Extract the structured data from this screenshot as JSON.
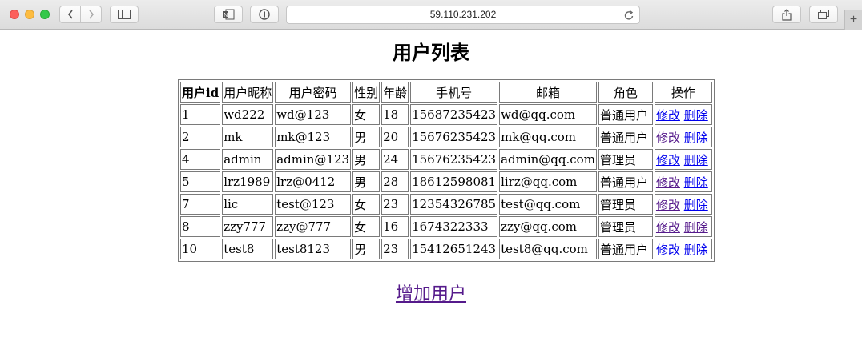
{
  "browser": {
    "address": "59.110.231.202",
    "icons": {
      "back": "chevron-left-icon",
      "forward": "chevron-right-icon",
      "sidebar": "sidebar-icon",
      "onenote": "onenote-icon",
      "password": "password-icon",
      "reload": "reload-icon",
      "share": "share-icon",
      "tabs": "tabs-icon",
      "new_tab": "plus-icon"
    },
    "new_tab_label": "+"
  },
  "page": {
    "title": "用户列表",
    "columns": [
      "用户id",
      "用户昵称",
      "用户密码",
      "性别",
      "年龄",
      "手机号",
      "邮箱",
      "角色",
      "操作"
    ],
    "rows": [
      {
        "id": "1",
        "nickname": "wd222",
        "password": "wd@123",
        "gender": "女",
        "age": "18",
        "phone": "15687235423",
        "email": "wd@qq.com",
        "role": "普通用户",
        "edit": "修改",
        "delete": "删除"
      },
      {
        "id": "2",
        "nickname": "mk",
        "password": "mk@123",
        "gender": "男",
        "age": "20",
        "phone": "15676235423",
        "email": "mk@qq.com",
        "role": "普通用户",
        "edit": "修改",
        "delete": "删除"
      },
      {
        "id": "4",
        "nickname": "admin",
        "password": "admin@123",
        "gender": "男",
        "age": "24",
        "phone": "15676235423",
        "email": "admin@qq.com",
        "role": "管理员",
        "edit": "修改",
        "delete": "删除"
      },
      {
        "id": "5",
        "nickname": "lrz1989",
        "password": "lrz@0412",
        "gender": "男",
        "age": "28",
        "phone": "18612598081",
        "email": "lirz@qq.com",
        "role": "普通用户",
        "edit": "修改",
        "delete": "删除"
      },
      {
        "id": "7",
        "nickname": "lic",
        "password": "test@123",
        "gender": "女",
        "age": "23",
        "phone": "12354326785",
        "email": "test@qq.com",
        "role": "管理员",
        "edit": "修改",
        "delete": "删除"
      },
      {
        "id": "8",
        "nickname": "zzy777",
        "password": "zzy@777",
        "gender": "女",
        "age": "16",
        "phone": "1674322333",
        "email": "zzy@qq.com",
        "role": "管理员",
        "edit": "修改",
        "delete": "删除"
      },
      {
        "id": "10",
        "nickname": "test8",
        "password": "test8123",
        "gender": "男",
        "age": "23",
        "phone": "15412651243",
        "email": "test8@qq.com",
        "role": "普通用户",
        "edit": "修改",
        "delete": "删除"
      }
    ],
    "add_user_link": "增加用户"
  },
  "colors": {
    "link": "#0000ee",
    "visited_link": "#551a8b"
  }
}
